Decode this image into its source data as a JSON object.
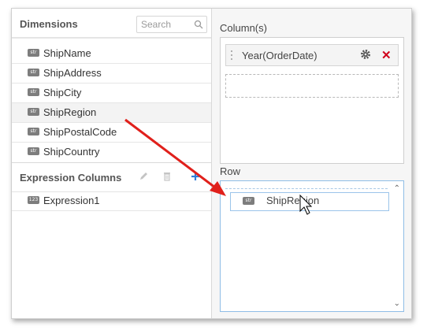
{
  "dimensions": {
    "title": "Dimensions",
    "search_placeholder": "Search",
    "fields": [
      {
        "type_badge": "str",
        "label": "ShipName"
      },
      {
        "type_badge": "str",
        "label": "ShipAddress"
      },
      {
        "type_badge": "str",
        "label": "ShipCity"
      },
      {
        "type_badge": "str",
        "label": "ShipRegion",
        "selected": true
      },
      {
        "type_badge": "str",
        "label": "ShipPostalCode"
      },
      {
        "type_badge": "str",
        "label": "ShipCountry"
      }
    ]
  },
  "expression_columns": {
    "title": "Expression Columns",
    "items": [
      {
        "type_badge": "123",
        "label": "Expression1"
      }
    ]
  },
  "columns_section": {
    "label": "Column(s)",
    "items": [
      {
        "label": "Year(OrderDate)"
      }
    ]
  },
  "row_section": {
    "label": "Row",
    "dragging_item": {
      "type_badge": "str",
      "label": "ShipRegion"
    }
  },
  "icons": {
    "search": "search-icon",
    "edit": "pencil-icon",
    "delete": "trash-icon",
    "add": "plus-icon",
    "settings": "gear-icon",
    "remove": "close-icon",
    "scroll_up": "chevron-up-icon",
    "scroll_down": "chevron-down-icon",
    "cursor": "cursor-icon",
    "annotation_arrow": "red-arrow"
  },
  "colors": {
    "accent": "#2f7ed8",
    "remove": "#d0021b",
    "annotation": "#e0201b",
    "badge": "#7d7d7d"
  }
}
